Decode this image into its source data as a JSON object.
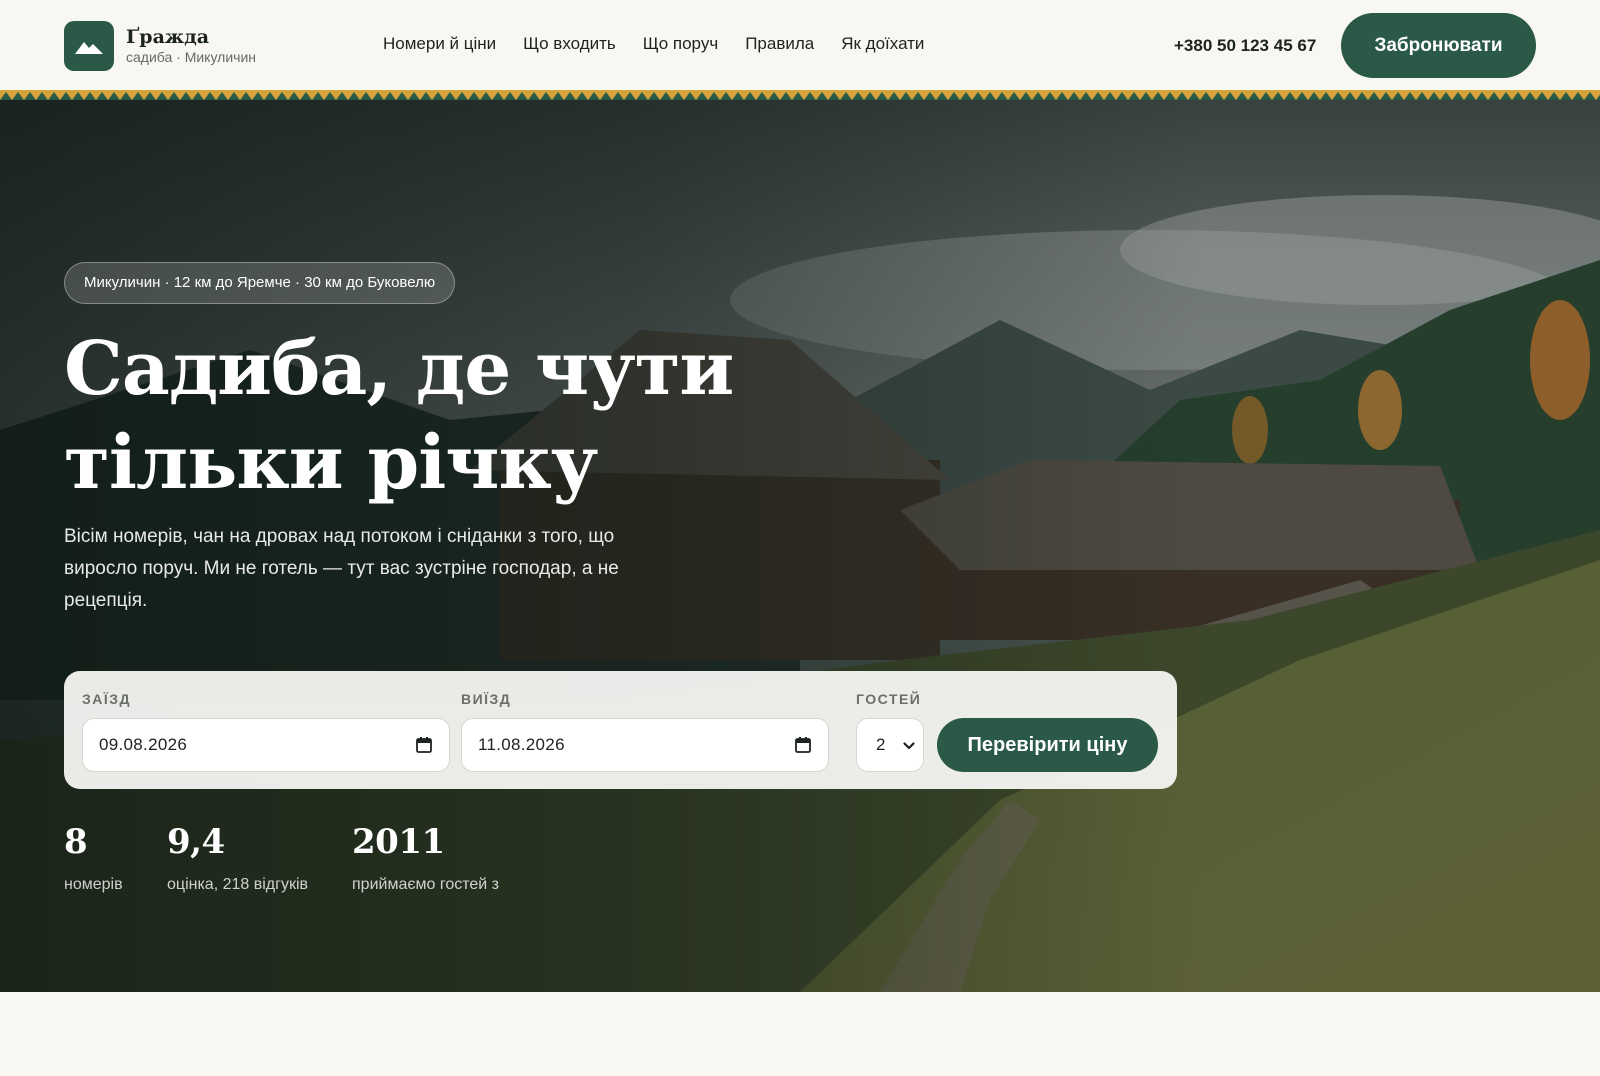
{
  "header": {
    "logo_name": "Ґражда",
    "logo_sub": "садиба · Микуличин",
    "nav": [
      {
        "label": "Номери й ціни"
      },
      {
        "label": "Що входить"
      },
      {
        "label": "Що поруч"
      },
      {
        "label": "Правила"
      },
      {
        "label": "Як доїхати"
      }
    ],
    "phone": "+380 50 123 45 67",
    "book_label": "Забронювати"
  },
  "hero": {
    "location": "Микуличин · 12 км до Яремче · 30 км до Буковелю",
    "title_line1": "Садиба, де чути",
    "title_line2": "тільки річку",
    "text": "Вісім номерів, чан на дровах над потоком і сніданки з того, що виросло поруч. Ми не готель — тут вас зустріне господар, а не рецепція."
  },
  "booking": {
    "checkin_label": "ЗАЇЗД",
    "checkin_value": "09.08.2026",
    "checkout_label": "ВИЇЗД",
    "checkout_value": "11.08.2026",
    "guests_label": "ГОСТЕЙ",
    "guests_value": "2",
    "submit_label": "Перевірити ціну"
  },
  "stats": [
    {
      "value": "8",
      "label": "номерів"
    },
    {
      "value": "9,4",
      "label": "оцінка, 218 відгуків"
    },
    {
      "value": "2011",
      "label": "приймаємо гостей з"
    }
  ],
  "colors": {
    "accent": "#2a5a47",
    "background": "#f8f7f1",
    "ornament_gold": "#d6a33c",
    "ornament_green": "#2a5a47"
  }
}
